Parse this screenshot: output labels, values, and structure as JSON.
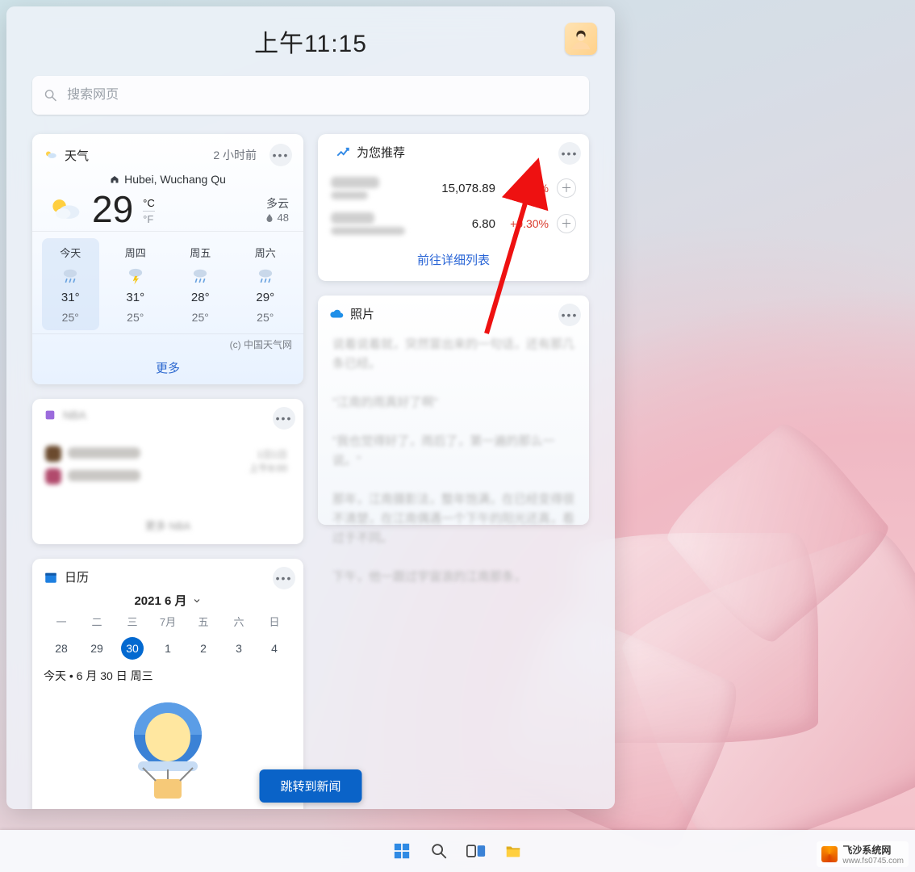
{
  "clock": "上午11:15",
  "search": {
    "placeholder": "搜索网页"
  },
  "weather": {
    "title": "天气",
    "updated": "2 小时前",
    "location": "Hubei, Wuchang Qu",
    "temp": "29",
    "unit_c": "°C",
    "unit_f": "°F",
    "cond": "多云",
    "humidity_label": "48",
    "days": [
      {
        "label": "今天",
        "hi": "31°",
        "lo": "25°"
      },
      {
        "label": "周四",
        "hi": "31°",
        "lo": "25°"
      },
      {
        "label": "周五",
        "hi": "28°",
        "lo": "25°"
      },
      {
        "label": "周六",
        "hi": "29°",
        "lo": "25°"
      }
    ],
    "credit": "(c) 中国天气网",
    "more": "更多"
  },
  "sports": {
    "title": "NBA",
    "footer": "更多 NBA",
    "time1": "1日1日",
    "time2": "上午8:00"
  },
  "calendar": {
    "title": "日历",
    "month_label": "2021 6 月",
    "weekdays": [
      "一",
      "二",
      "三",
      "7月",
      "五",
      "六",
      "日"
    ],
    "row": [
      "28",
      "29",
      "30",
      "1",
      "2",
      "3",
      "4"
    ],
    "selected_index": 2,
    "today_line": "今天 • 6 月 30 日 周三"
  },
  "recommend": {
    "title": "为您推荐",
    "rows": [
      {
        "value": "15,078.89",
        "pct": "+0.53%"
      },
      {
        "value": "6.80",
        "pct": "+0.30%"
      }
    ],
    "link": "前往详细列表"
  },
  "photos": {
    "title": "照片"
  },
  "jump_button": "跳转到新闻",
  "watermark": {
    "brand": "飞沙系统网",
    "url": "www.fs0745.com"
  }
}
